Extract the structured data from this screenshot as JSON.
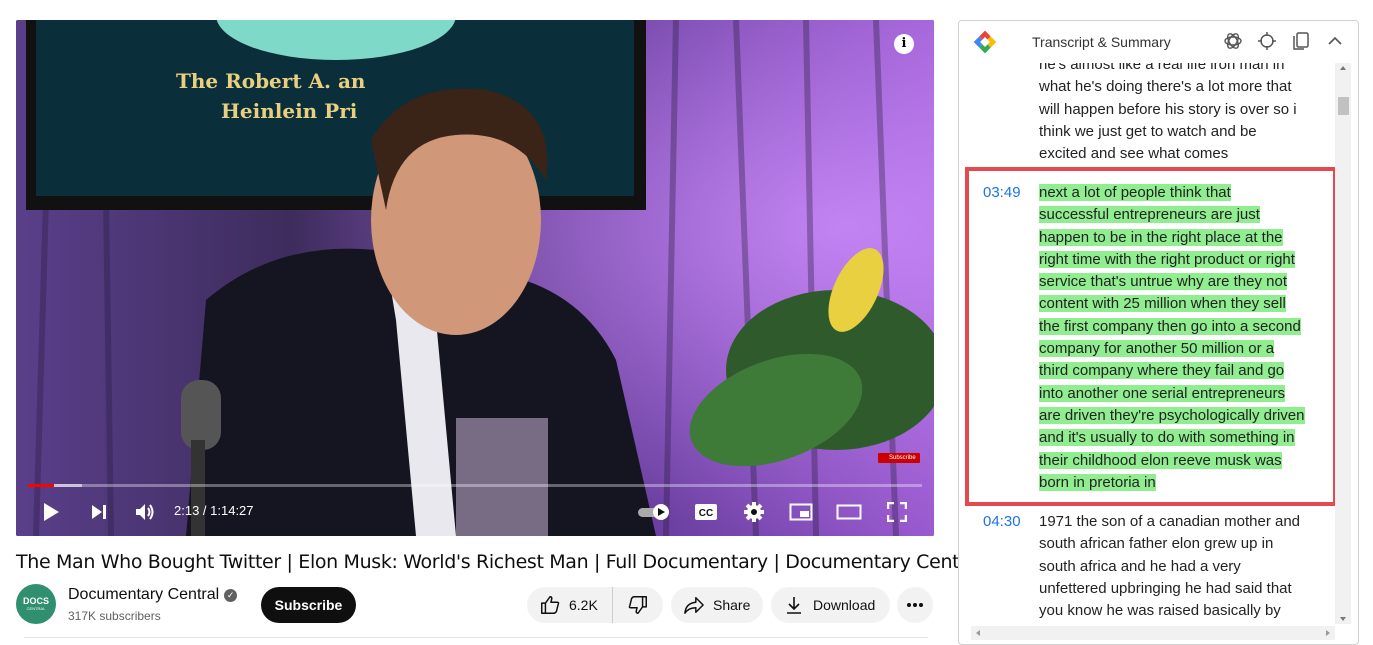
{
  "video": {
    "scene_sign_line1": "The Robert A. an",
    "scene_sign_line2": "Heinlein Pri",
    "watermark_label": "Subscribe",
    "info_icon": "info-icon",
    "progress_played_fraction": 0.029,
    "progress_loaded_fraction": 0.06,
    "time": "2:13 / 1:14:27",
    "controls": [
      "play-icon",
      "next-icon",
      "volume-icon",
      "autoplay-toggle-icon",
      "captions-icon",
      "settings-icon",
      "miniplayer-icon",
      "theater-icon",
      "fullscreen-icon"
    ]
  },
  "title": "The Man Who Bought Twitter | Elon Musk: World's Richest Man | Full Documentary | Documentary Central",
  "channel": {
    "avatar_text": "DOCS",
    "avatar_subtext": "CENTRAL",
    "name": "Documentary Central",
    "subscribers": "317K subscribers",
    "subscribe_label": "Subscribe"
  },
  "actions": {
    "likes": "6.2K",
    "share_label": "Share",
    "download_label": "Download"
  },
  "panel": {
    "title": "Transcript & Summary",
    "segments": [
      {
        "time": "",
        "lines": [
          "he's almost like a real life iron man in",
          "what he's doing there's a lot more that",
          "will happen before his story is over so i",
          "think we just get to watch and be",
          "excited and see what comes"
        ]
      },
      {
        "time": "03:49",
        "active": true,
        "lines": [
          "next a lot of people think that",
          "successful entrepreneurs are just",
          "happen to be in the right place at the",
          "right time with the right product or right",
          "service that's untrue why are they not",
          "content with 25 million when they sell",
          "the first company then go into a second",
          "company for another 50 million or a",
          "third company where they fail and go",
          "into another one serial entrepreneurs",
          "are driven they're psychologically driven",
          "and it's usually to do with something in",
          "their childhood elon reeve musk was",
          "born in pretoria in"
        ]
      },
      {
        "time": "04:30",
        "lines": [
          "1971 the son of a canadian mother and",
          "south african father elon grew up in",
          "south africa and he had a very",
          "unfettered upbringing he had said that",
          "you know he was raised basically by"
        ]
      }
    ]
  },
  "colors": {
    "highlight": "#90ee90",
    "active_border": "#e5484d",
    "timestamp": "#1a73e8",
    "progress": "#ff0000"
  }
}
